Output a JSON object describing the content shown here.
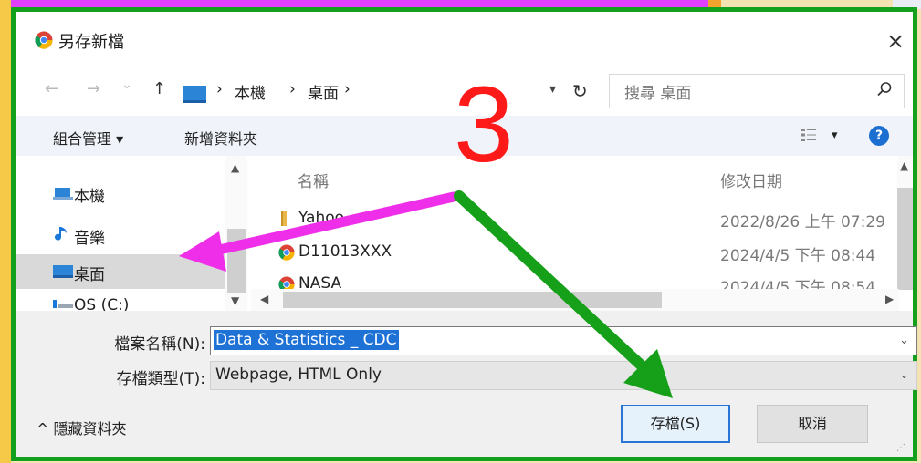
{
  "dialog": {
    "title": "另存新檔",
    "close_glyph": "×"
  },
  "nav": {
    "back_glyph": "←",
    "forward_glyph": "→",
    "recent_glyph": "⌄",
    "up_glyph": "↑",
    "breadcrumb": [
      "本機",
      "桌面"
    ],
    "separator": "›",
    "refresh_glyph": "↻",
    "search_placeholder": "搜尋 桌面",
    "search_glyph": "⚲"
  },
  "toolbar": {
    "organize_label": "組合管理 ▾",
    "new_folder_label": "新增資料夾",
    "view_glyph": "▾",
    "help_glyph": "?"
  },
  "sidebar": {
    "items": [
      {
        "label": "本機",
        "icon": "computer-icon"
      },
      {
        "label": "音樂",
        "icon": "music-note-icon"
      },
      {
        "label": "桌面",
        "icon": "desktop-icon",
        "selected": true
      },
      {
        "label": "OS (C:)",
        "icon": "drive-icon"
      }
    ]
  },
  "files": {
    "columns": {
      "name": "名稱",
      "modified": "修改日期"
    },
    "rows": [
      {
        "name": "Yahoo",
        "modified": "2022/8/26 上午 07:29",
        "icon": "folder-icon"
      },
      {
        "name": "D11013XXX",
        "modified": "2024/4/5 下午 08:44",
        "icon": "chrome-icon"
      },
      {
        "name": "NASA",
        "modified": "2024/4/5 下午 08:54",
        "icon": "chrome-icon"
      }
    ]
  },
  "form": {
    "filename_label": "檔案名稱(N):",
    "filename_value": "Data & Statistics _ CDC",
    "filetype_label": "存檔類型(T):",
    "filetype_value": "Webpage, HTML Only",
    "hide_folders_label": "^ 隱藏資料夾",
    "save_label": "存檔(S)",
    "cancel_label": "取消"
  },
  "annotation": {
    "step_number": "3",
    "number_color": "#ff1a1a",
    "magenta_arrow_color": "#ee2ee8",
    "green_arrow_color": "#16a019"
  },
  "colors": {
    "highlight_border": "#14a01e",
    "accent_blue": "#1e72d6"
  }
}
